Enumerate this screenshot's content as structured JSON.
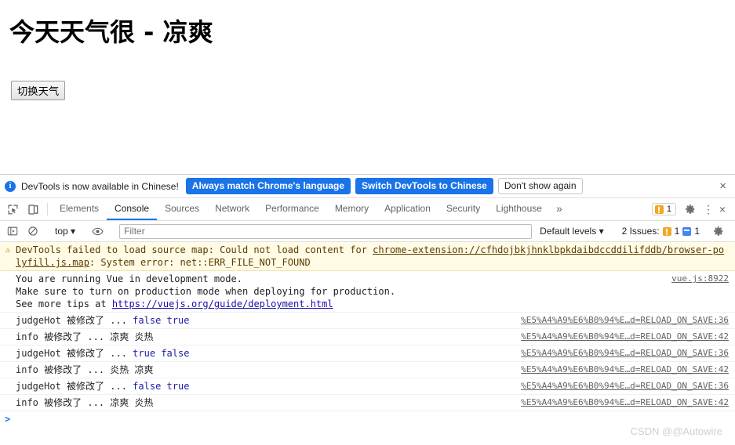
{
  "page": {
    "heading": "今天天气很 - 凉爽",
    "toggle_button_label": "切换天气"
  },
  "devtools": {
    "infobar": {
      "icon": "info-icon",
      "text": "DevTools is now available in Chinese!",
      "primary_button_1": "Always match Chrome's language",
      "primary_button_2": "Switch DevTools to Chinese",
      "secondary_button": "Don't show again",
      "close_label": "×",
      "accent_color": "#1a73e8"
    },
    "tabs": [
      {
        "label": "Elements",
        "active": false
      },
      {
        "label": "Console",
        "active": true
      },
      {
        "label": "Sources",
        "active": false
      },
      {
        "label": "Network",
        "active": false
      },
      {
        "label": "Performance",
        "active": false
      },
      {
        "label": "Memory",
        "active": false
      },
      {
        "label": "Application",
        "active": false
      },
      {
        "label": "Security",
        "active": false
      },
      {
        "label": "Lighthouse",
        "active": false
      }
    ],
    "tabs_overflow_label": "»",
    "tabbar_right": {
      "warning_count": "1",
      "settings_label": "⚙",
      "more_label": "⋮",
      "close_label": "×"
    },
    "console_toolbar": {
      "context": "top",
      "context_caret": "▾",
      "filter_placeholder": "Filter",
      "filter_value": "",
      "levels": "Default levels",
      "levels_caret": "▾",
      "issues_label": "2 Issues:",
      "issues_warning_count": "1",
      "issues_info_count": "1",
      "settings_label": "⚙"
    },
    "messages": [
      {
        "type": "warning",
        "icon": "warning-triangle-icon",
        "text_before": "DevTools failed to load source map: Could not load content for ",
        "link": "chrome-extension://cfhdojbkjhnklbpkdaibdccddilifddb/browser-polyfill.js.map",
        "text_after": ": System error: net::ERR_FILE_NOT_FOUND",
        "source": ""
      },
      {
        "type": "info",
        "lines": [
          "You are running Vue in development mode.",
          "Make sure to turn on production mode when deploying for production.",
          "See more tips at "
        ],
        "tail_link": "https://vuejs.org/guide/deployment.html",
        "source": "vue.js:8922"
      }
    ],
    "logs": [
      {
        "name": "judgeHot",
        "label": "被修改了 ...",
        "old": "false",
        "new": "true",
        "kind": "bool",
        "source": "%E5%A4%A9%E6%B0%94%E…d=RELOAD_ON_SAVE:36"
      },
      {
        "name": "info",
        "label": "被修改了 ...",
        "old": "凉爽",
        "new": "炎热",
        "kind": "text",
        "source": "%E5%A4%A9%E6%B0%94%E…d=RELOAD_ON_SAVE:42"
      },
      {
        "name": "judgeHot",
        "label": "被修改了 ...",
        "old": "true",
        "new": "false",
        "kind": "bool",
        "source": "%E5%A4%A9%E6%B0%94%E…d=RELOAD_ON_SAVE:36"
      },
      {
        "name": "info",
        "label": "被修改了 ...",
        "old": "炎热",
        "new": "凉爽",
        "kind": "text",
        "source": "%E5%A4%A9%E6%B0%94%E…d=RELOAD_ON_SAVE:42"
      },
      {
        "name": "judgeHot",
        "label": "被修改了 ...",
        "old": "false",
        "new": "true",
        "kind": "bool",
        "source": "%E5%A4%A9%E6%B0%94%E…d=RELOAD_ON_SAVE:36"
      },
      {
        "name": "info",
        "label": "被修改了 ...",
        "old": "凉爽",
        "new": "炎热",
        "kind": "text",
        "source": "%E5%A4%A9%E6%B0%94%E…d=RELOAD_ON_SAVE:42"
      }
    ],
    "prompt": {
      "chevron": ">",
      "value": ""
    }
  },
  "watermark": "CSDN @@Autowire"
}
